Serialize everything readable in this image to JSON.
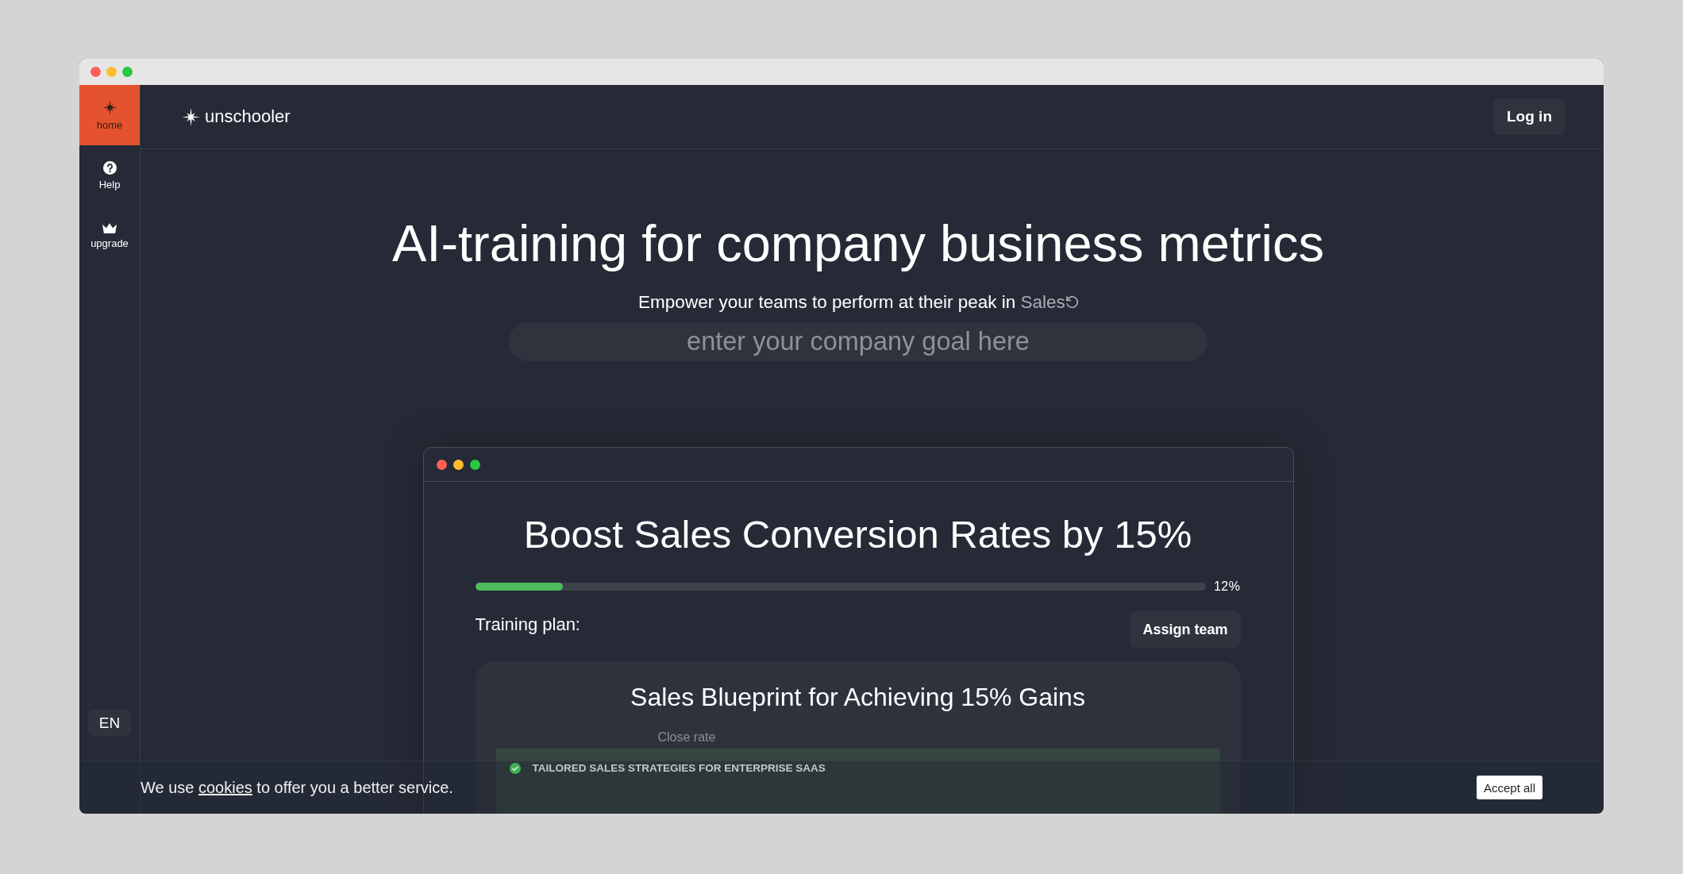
{
  "sidebar": {
    "items": [
      {
        "kind": "home",
        "label": "home",
        "selected": true
      },
      {
        "kind": "help",
        "label": "Help",
        "selected": false
      },
      {
        "kind": "upgrade",
        "label": "upgrade",
        "selected": false
      }
    ],
    "language": "EN"
  },
  "header": {
    "logo": "unschooler",
    "login_button": "Log in"
  },
  "hero": {
    "title": "AI-training for company business metrics",
    "subtitle": "Empower your teams to perform at their peak in",
    "subtitle_topic": "Sales",
    "goal_field": {
      "placeholder": "enter your company goal here"
    }
  },
  "demo_window": {
    "goal_title": "Boost Sales Conversion Rates by 15%",
    "progress": {
      "level": 0.12,
      "reading": "12%"
    },
    "plan_label": "Training plan:",
    "assign_button": "Assign team",
    "plan_card": {
      "title": "Sales Blueprint for Achieving 15% Gains",
      "metric_label": "Close rate",
      "modules": [
        {
          "title": "TAILORED SALES STRATEGIES FOR ENTERPRISE SAAS",
          "completed": true
        }
      ]
    }
  },
  "cookie_banner": {
    "message_start": "We use",
    "link": "cookies",
    "message_end": "to offer you a better service.",
    "accept_button": "Accept all"
  }
}
